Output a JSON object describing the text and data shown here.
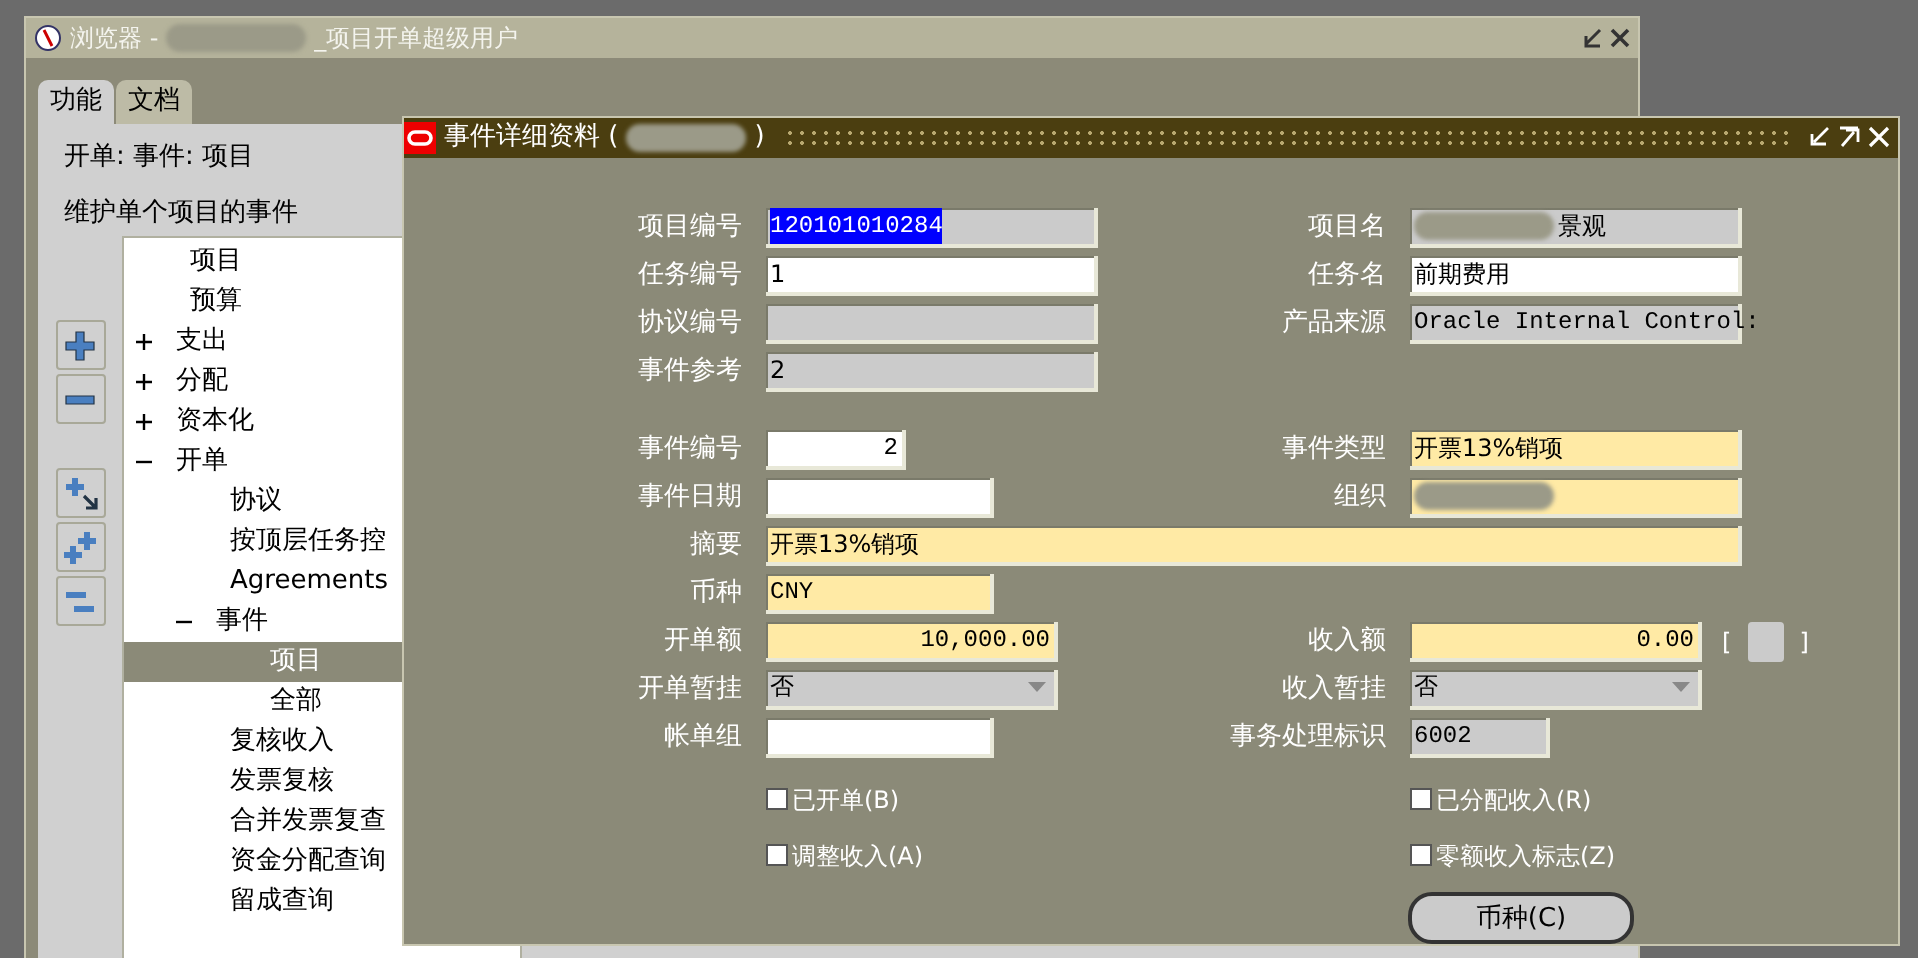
{
  "browser_window": {
    "title_prefix": "浏览器 -",
    "title_redacted": true,
    "title_suffix": "_项目开单超级用户",
    "tabs": [
      {
        "label": "功能",
        "selected": true
      },
      {
        "label": "文档",
        "selected": false
      }
    ],
    "path": "开单: 事件: 项目",
    "description": "维护单个项目的事件",
    "tree": [
      {
        "label": "项目",
        "selected": false
      },
      {
        "label": "预算",
        "selected": false
      },
      {
        "label": "支出",
        "expanded": false,
        "selected": false
      },
      {
        "label": "分配",
        "expanded": false,
        "selected": false
      },
      {
        "label": "资本化",
        "expanded": false,
        "selected": false
      },
      {
        "label": "开单",
        "expanded": true,
        "selected": false,
        "children": [
          {
            "label": "协议",
            "selected": false
          },
          {
            "label": "按顶层任务控",
            "selected": false
          },
          {
            "label": "Agreements",
            "selected": false
          },
          {
            "label": "事件",
            "expanded": true,
            "selected": false,
            "children": [
              {
                "label": "项目",
                "selected": true
              },
              {
                "label": "全部",
                "selected": false
              }
            ]
          },
          {
            "label": "复核收入",
            "selected": false
          },
          {
            "label": "发票复核",
            "selected": false
          },
          {
            "label": "合并发票复查",
            "selected": false
          },
          {
            "label": "资金分配查询",
            "selected": false
          },
          {
            "label": "留成查询",
            "selected": false
          }
        ]
      }
    ]
  },
  "dialog": {
    "title": "事件详细资料 (",
    "title_redacted": true,
    "title_end": ")",
    "sections": [
      [
        {
          "left": {
            "label": "项目编号",
            "value": "120101010284",
            "kind": "code",
            "readonly": true,
            "required": false,
            "selected": true
          },
          "right": {
            "label": "项目名",
            "value": "景观",
            "redacted": true,
            "kind": "text",
            "readonly": true,
            "required": false
          }
        },
        {
          "left": {
            "label": "任务编号",
            "value": "1",
            "kind": "text",
            "readonly": false,
            "required": false
          },
          "right": {
            "label": "任务名",
            "value": "前期费用",
            "kind": "text",
            "readonly": false,
            "required": false
          }
        },
        {
          "left": {
            "label": "协议编号",
            "kind": "text",
            "readonly": true,
            "required": false
          },
          "right": {
            "label": "产品来源",
            "value": "Oracle Internal Control:",
            "kind": "code",
            "readonly": true,
            "required": false
          }
        },
        {
          "left": {
            "label": "事件参考",
            "value": "2",
            "kind": "text",
            "readonly": true,
            "required": false
          }
        }
      ],
      [
        {
          "left": {
            "label": "事件编号",
            "value": "2",
            "kind": "number",
            "readonly": false,
            "required": false
          },
          "right": {
            "label": "事件类型",
            "value": "开票13%销项",
            "kind": "text",
            "readonly": false,
            "required": true
          }
        },
        {
          "left": {
            "label": "事件日期",
            "kind": "text",
            "readonly": false,
            "required": false
          },
          "right": {
            "label": "组织",
            "redacted": true,
            "kind": "text",
            "readonly": false,
            "required": true
          }
        },
        {
          "left": {
            "label": "摘要",
            "value": "开票13%销项",
            "kind": "text",
            "readonly": false,
            "required": true
          }
        },
        {
          "left": {
            "label": "币种",
            "value": "CNY",
            "kind": "code",
            "readonly": false,
            "required": true
          }
        },
        {
          "left": {
            "label": "开单额",
            "value": "10,000.00",
            "kind": "number",
            "readonly": false,
            "required": true
          },
          "right": {
            "label": "收入额",
            "value": "0.00",
            "kind": "number",
            "readonly": false,
            "required": true,
            "flex_field": {
              "open": "[",
              "close": "]"
            }
          }
        },
        {
          "left": {
            "label": "开单暂挂",
            "value": "否",
            "kind": "select",
            "readonly": true,
            "required": false
          },
          "right": {
            "label": "收入暂挂",
            "value": "否",
            "kind": "select",
            "readonly": true,
            "required": false
          }
        },
        {
          "left": {
            "label": "帐单组",
            "kind": "text",
            "readonly": false,
            "required": false
          },
          "right": {
            "label": "事务处理标识",
            "value": "6002",
            "kind": "code",
            "readonly": true,
            "required": false
          }
        }
      ]
    ],
    "checkboxes": [
      {
        "left": {
          "label": "已开单(B)",
          "checked": false
        },
        "right": {
          "label": "已分配收入(R)",
          "checked": false
        }
      },
      {
        "left": {
          "label": "调整收入(A)",
          "checked": false
        },
        "right": {
          "label": "零额收入标志(Z)",
          "checked": false
        }
      }
    ],
    "button": "币种(C)"
  }
}
